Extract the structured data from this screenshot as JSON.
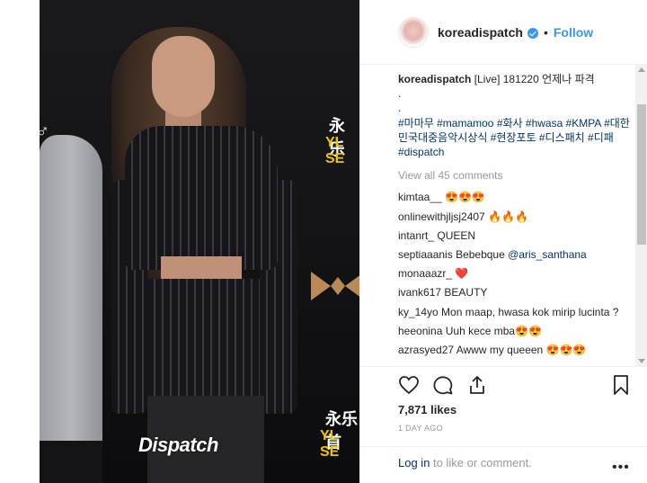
{
  "photo": {
    "watermark": "Dispatch",
    "backdrop_texts": [
      "永乐",
      "YL SE",
      "永乐首",
      "YL SE"
    ]
  },
  "post": {
    "username": "koreadispatch",
    "follow_label": "Follow",
    "separator": "•",
    "caption_user": "koreadispatch",
    "caption_text": "[Live] 181220 언제나 파격",
    "caption_dots": [
      ".",
      " ."
    ],
    "hashtags": "#마마무 #mamamoo #화사 #hwasa #KMPA #대한민국대중음악시상식 #현장포토 #디스패치 #디패 #dispatch",
    "view_all": "View all 45 comments",
    "comments": [
      {
        "user": "kimtaa__",
        "text": "😍😍😍"
      },
      {
        "user": "onlinewithjljsj2407",
        "text": "🔥🔥🔥"
      },
      {
        "user": "intanrt_",
        "text": "QUEEN"
      },
      {
        "user": "septiaaanis",
        "text": "Bebebque",
        "mention": "@aris_santhana"
      },
      {
        "user": "monaaazr_",
        "text": "❤️"
      },
      {
        "user": "ivank617",
        "text": "BEAUTY"
      },
      {
        "user": "ky_14yo",
        "text": "Mon maap, hwasa kok mirip lucinta ?"
      },
      {
        "user": "heeonina",
        "text": "Uuh kece mba😍😍"
      },
      {
        "user": "azrasyed27",
        "text": "Awww my queeen 😍😍😍"
      }
    ],
    "likes": "7,871 likes",
    "time": "1 DAY AGO",
    "login_link": "Log in",
    "login_rest": " to like or comment.",
    "more": "•••"
  },
  "icons": {
    "like": "heart-icon",
    "comment": "comment-icon",
    "share": "share-icon",
    "save": "bookmark-icon",
    "verified": "verified-badge-icon"
  },
  "colors": {
    "link": "#003569",
    "follow": "#3897f0",
    "muted": "#999999"
  }
}
